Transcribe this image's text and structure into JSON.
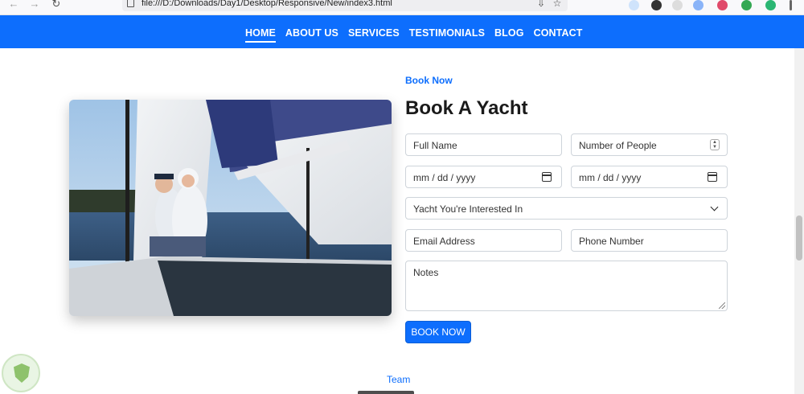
{
  "browser": {
    "url": "file:///D:/Downloads/Day1/Desktop/Responsive/New/index3.html"
  },
  "nav": {
    "items": [
      {
        "label": "HOME",
        "active": true
      },
      {
        "label": "ABOUT US",
        "active": false
      },
      {
        "label": "SERVICES",
        "active": false
      },
      {
        "label": "TESTIMONIALS",
        "active": false
      },
      {
        "label": "BLOG",
        "active": false
      },
      {
        "label": "CONTACT",
        "active": false
      }
    ]
  },
  "booking": {
    "eyebrow": "Book Now",
    "title": "Book A Yacht",
    "full_name_placeholder": "Full Name",
    "people_placeholder": "Number of People",
    "date1_value": "mm / dd / yyyy",
    "date2_value": "mm / dd / yyyy",
    "yacht_select": "Yacht You're Interested In",
    "email_placeholder": "Email Address",
    "phone_placeholder": "Phone Number",
    "notes_placeholder": "Notes",
    "submit_label": "BOOK NOW"
  },
  "team": {
    "eyebrow": "Team"
  },
  "colors": {
    "primary": "#0d6efd",
    "heading": "#1a1a1a"
  }
}
